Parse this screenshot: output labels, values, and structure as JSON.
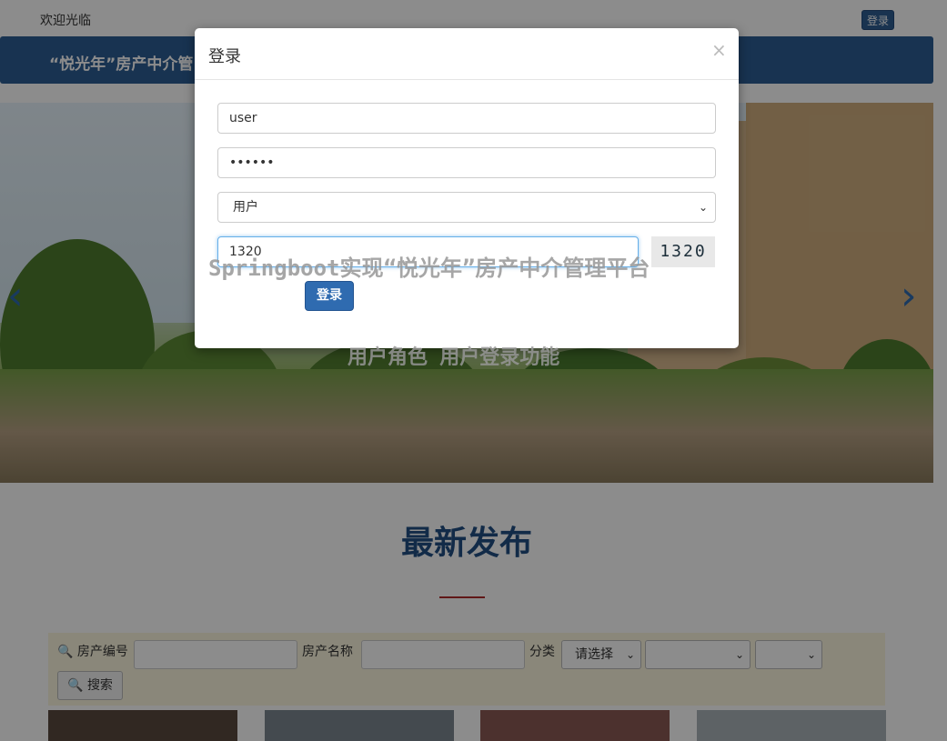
{
  "topbar": {
    "welcome": "欢迎光临",
    "login_button": "登录"
  },
  "navbar": {
    "site_title": "“悦光年”房产中介管"
  },
  "carousel": {
    "prev_icon": "chevron-left-icon",
    "next_icon": "chevron-right-icon"
  },
  "latest": {
    "title": "最新发布"
  },
  "search": {
    "code_label": "房产编号",
    "name_label": "房产名称",
    "category_label": "分类",
    "category_value": "请选择",
    "search_button": "搜索"
  },
  "login_modal": {
    "title": "登录",
    "close": "×",
    "username": "user",
    "password": "••••••",
    "role": "用户",
    "captcha_input": "1320",
    "captcha_image": "1320",
    "submit": "登录"
  },
  "watermarks": {
    "line1": "Springboot实现“悦光年”房产中介管理平台",
    "line2": "用户角色 用户登录功能"
  },
  "colors": {
    "primary": "#2f6bb0",
    "navbar": "#2c5d94",
    "accent_line": "#b02b2b"
  }
}
